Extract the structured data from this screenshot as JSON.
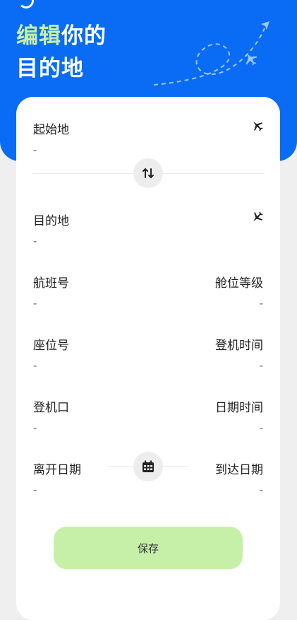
{
  "header": {
    "title_accent": "编辑",
    "title_rest": "你的",
    "title_line2": "目的地"
  },
  "form": {
    "origin": {
      "label": "起始地",
      "value": "-"
    },
    "destination": {
      "label": "目的地",
      "value": "-"
    },
    "flight_number": {
      "label": "航班号",
      "value": "-"
    },
    "cabin_class": {
      "label": "舱位等级",
      "value": "-"
    },
    "seat_number": {
      "label": "座位号",
      "value": "-"
    },
    "boarding_time": {
      "label": "登机时间",
      "value": "-"
    },
    "gate": {
      "label": "登机口",
      "value": "-"
    },
    "date_time": {
      "label": "日期时间",
      "value": "-"
    },
    "departure_date": {
      "label": "离开日期",
      "value": "-"
    },
    "arrival_date": {
      "label": "到达日期",
      "value": "-"
    }
  },
  "save_label": "保存",
  "icons": {
    "origin": "takeoff-icon",
    "destination": "landing-icon",
    "swap": "swap-icon",
    "calendar": "calendar-icon"
  },
  "colors": {
    "header_bg": "#0a6cf5",
    "accent_text": "#c7f0a6",
    "save_bg": "#c6f0a8"
  }
}
